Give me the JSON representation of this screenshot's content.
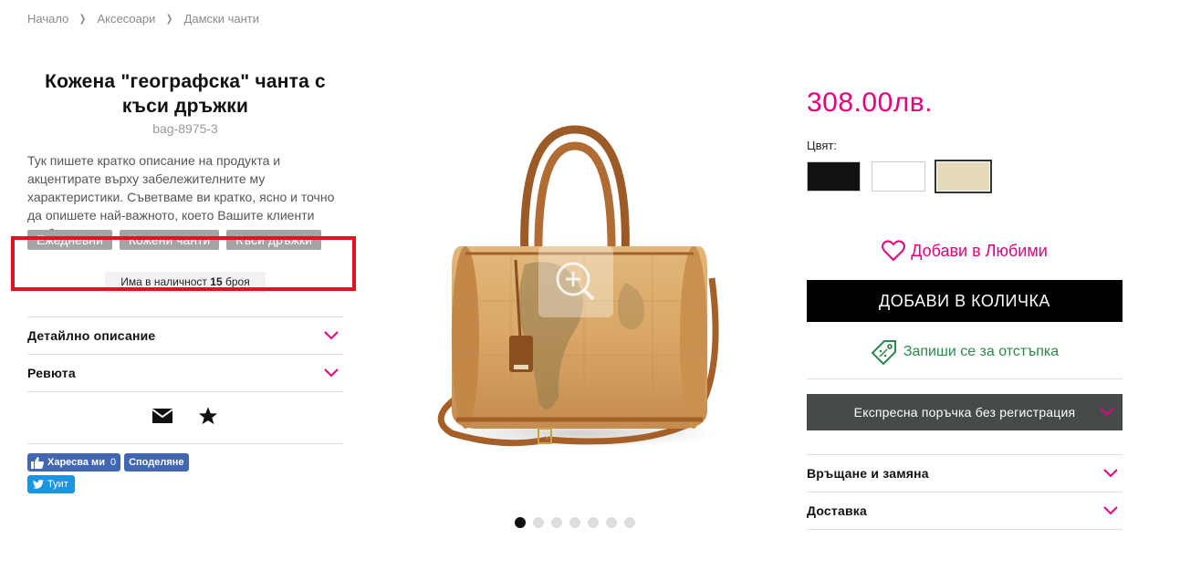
{
  "breadcrumb": {
    "items": [
      "Начало",
      "Аксесоари",
      "Дамски чанти"
    ],
    "separator": "❯"
  },
  "product": {
    "title": "Кожена \"географска\" чанта с къси дръжки",
    "sku": "bag-8975-3",
    "short_description": "Тук пишете кратко описание на продукта и акцентирате върху забележителните му характеристики. Съветваме ви кратко, ясно и точно да опишете най-важното, което Вашите клиенти трябва да знаят.",
    "tags": [
      "Ежедневни",
      "Кожени чанти",
      "Къси дръжки"
    ],
    "stock": {
      "prefix": "Има в наличност",
      "count": "15",
      "suffix": "броя"
    },
    "price": "308.00лв."
  },
  "left_accordion": [
    "Детайлно описание",
    "Ревюта"
  ],
  "share": {
    "icons": [
      "mail-icon",
      "star-icon"
    ],
    "fb_like_label": "Харесва ми",
    "fb_like_count": "0",
    "fb_share_label": "Споделяне",
    "tweet_label": "Туит"
  },
  "gallery": {
    "dot_count": 7,
    "active_index": 0
  },
  "options": {
    "color_label": "Цвят:",
    "colors": [
      "#111111",
      "#ffffff",
      "#e6dbb8"
    ],
    "selected_color_index": 2
  },
  "actions": {
    "favorites_label": "Добави в Любими",
    "add_to_cart_label": "ДОБАВИ В КОЛИЧКА",
    "discount_label": "Запиши се за отстъпка",
    "express_order_label": "Експресна поръчка без регистрация"
  },
  "right_accordion": [
    "Връщане и замяна",
    "Доставка"
  ],
  "colors": {
    "accent": "#e5007d",
    "button_dark": "#000000",
    "express_bg": "#474a4b",
    "discount_green": "#2a8a4a",
    "highlight_red": "#e0141e"
  }
}
